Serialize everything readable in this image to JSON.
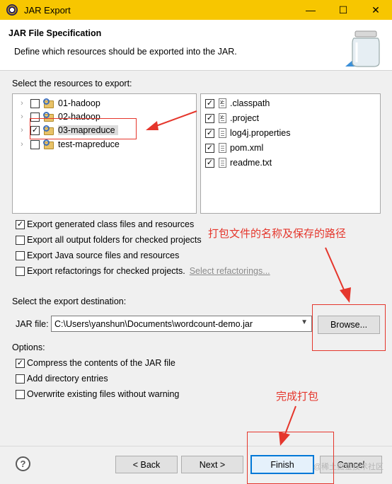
{
  "window": {
    "title": "JAR Export",
    "minimize_glyph": "—",
    "maximize_glyph": "☐",
    "close_glyph": "✕"
  },
  "header": {
    "title": "JAR File Specification",
    "description": "Define which resources should be exported into the JAR.",
    "icon": "jar-icon"
  },
  "resources": {
    "label": "Select the resources to export:",
    "projects": [
      {
        "name": "01-hadoop",
        "checked": false,
        "selected": false
      },
      {
        "name": "02-hadoop",
        "checked": false,
        "selected": false
      },
      {
        "name": "03-mapreduce",
        "checked": true,
        "selected": true
      },
      {
        "name": "test-mapreduce",
        "checked": false,
        "selected": false
      }
    ],
    "files": [
      {
        "name": ".classpath",
        "checked": true,
        "icon": "x-file-icon"
      },
      {
        "name": ".project",
        "checked": true,
        "icon": "x-file-icon"
      },
      {
        "name": "log4j.properties",
        "checked": true,
        "icon": "file-icon"
      },
      {
        "name": "pom.xml",
        "checked": true,
        "icon": "file-icon"
      },
      {
        "name": "readme.txt",
        "checked": true,
        "icon": "file-icon"
      }
    ]
  },
  "export_options": [
    {
      "label": "Export generated class files and resources",
      "checked": true
    },
    {
      "label": "Export all output folders for checked projects",
      "checked": false
    },
    {
      "label": "Export Java source files and resources",
      "checked": false
    },
    {
      "label": "Export refactorings for checked projects.",
      "checked": false,
      "link": "Select refactorings..."
    }
  ],
  "destination": {
    "label": "Select the export destination:",
    "jar_label": "JAR file:",
    "jar_value": "C:\\Users\\yanshun\\Documents\\wordcount-demo.jar",
    "browse_label": "Browse..."
  },
  "options": {
    "label": "Options:",
    "items": [
      {
        "label": "Compress the contents of the JAR file",
        "checked": true
      },
      {
        "label": "Add directory entries",
        "checked": false
      },
      {
        "label": "Overwrite existing files without warning",
        "checked": false
      }
    ]
  },
  "buttons": {
    "back": "< Back",
    "next": "Next >",
    "finish": "Finish",
    "cancel": "Cancel",
    "help": "?"
  },
  "annotations": {
    "package_path_note": "打包文件的名称及保存的路径",
    "finish_note": "完成打包",
    "color": "#e5362c"
  },
  "watermark": "@稀土掘金技术社区",
  "colors": {
    "titlebar": "#f7c600",
    "focus_border": "#0078d7",
    "annotation": "#e5362c"
  }
}
